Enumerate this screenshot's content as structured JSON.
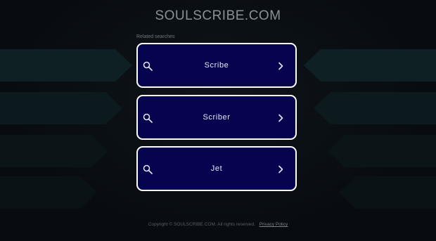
{
  "header": {
    "site_title": "SOULSCRIBE.COM"
  },
  "related": {
    "label": "Related searches",
    "items": [
      {
        "label": "Scribe",
        "icon": "search-icon",
        "arrow_icon": "chevron-right-icon"
      },
      {
        "label": "Scriber",
        "icon": "search-icon",
        "arrow_icon": "chevron-right-icon"
      },
      {
        "label": "Jet",
        "icon": "search-icon",
        "arrow_icon": "chevron-right-icon"
      }
    ]
  },
  "footer": {
    "copyright": "Copyright © SOULSCRIBE.COM.  All rights reserved.",
    "privacy_label": "Privacy Policy"
  },
  "colors": {
    "background": "#080c10",
    "button_bg": "#06044f",
    "button_border": "#ffffff",
    "decor": "#0f1b1f"
  }
}
